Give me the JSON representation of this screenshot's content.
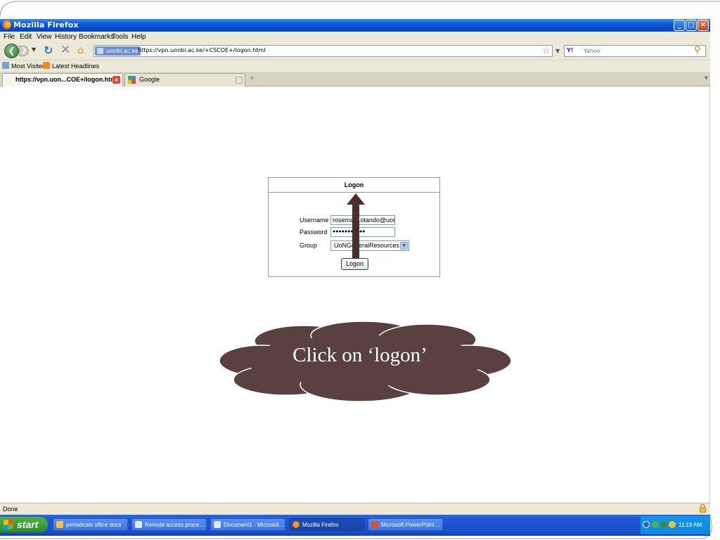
{
  "window": {
    "title": "Mozilla Firefox",
    "controls": {
      "minimize": "_",
      "maximize": "□",
      "close": "×"
    }
  },
  "menu": [
    "File",
    "Edit",
    "View",
    "History",
    "Bookmarks",
    "Tools",
    "Help"
  ],
  "nav": {
    "site_identity": "uonbi.ac.ke",
    "url": "https://vpn.uonbi.ac.ke/+CSCOE+/logon.html",
    "search_engine": "Y!",
    "search_placeholder": "Yahoo"
  },
  "bookmarks": [
    {
      "label": "Most Visited",
      "icon": "page-icon"
    },
    {
      "label": "Latest Headlines",
      "icon": "rss-icon"
    }
  ],
  "tabs": [
    {
      "label": "https://vpn.uon...COE+/logon.html",
      "active": true
    },
    {
      "label": "Google",
      "active": false
    }
  ],
  "logon": {
    "title": "Logon",
    "username_label": "Username",
    "username_value": "rosemary.otando@uon",
    "password_label": "Password",
    "password_value": "●●●●●●●●●●●",
    "group_label": "Group",
    "group_value": "UoNGeneralResources",
    "button_label": "Logon"
  },
  "annotation": {
    "text": "Click on ‘logon’",
    "cloud_color": "#5a4040"
  },
  "status": {
    "text": "Done"
  },
  "taskbar": {
    "start_label": "start",
    "tasks": [
      {
        "label": "periodicals office docs",
        "icon": "folder-icon"
      },
      {
        "label": "Remote access proce...",
        "icon": "word-icon"
      },
      {
        "label": "Document1 - Microsof...",
        "icon": "word-icon"
      },
      {
        "label": "Mozilla Firefox",
        "icon": "firefox-icon"
      },
      {
        "label": "Microsoft PowerPoint ...",
        "icon": "powerpoint-icon"
      }
    ],
    "clock": "11:19 AM"
  }
}
